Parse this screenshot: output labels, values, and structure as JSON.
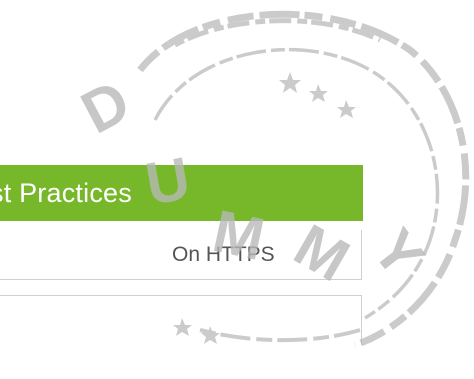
{
  "card": {
    "header_title": "st Practices",
    "items": [
      {
        "label": "On HTTPS"
      },
      {
        "label": ""
      }
    ]
  },
  "watermark": {
    "text": "DUMMY",
    "icon": "dummy-stamp-icon",
    "color": "#b8b8b8"
  },
  "colors": {
    "header_bg": "#76b82a",
    "header_text": "#ffffff",
    "item_text": "#555555",
    "border": "#cfcfcf"
  }
}
